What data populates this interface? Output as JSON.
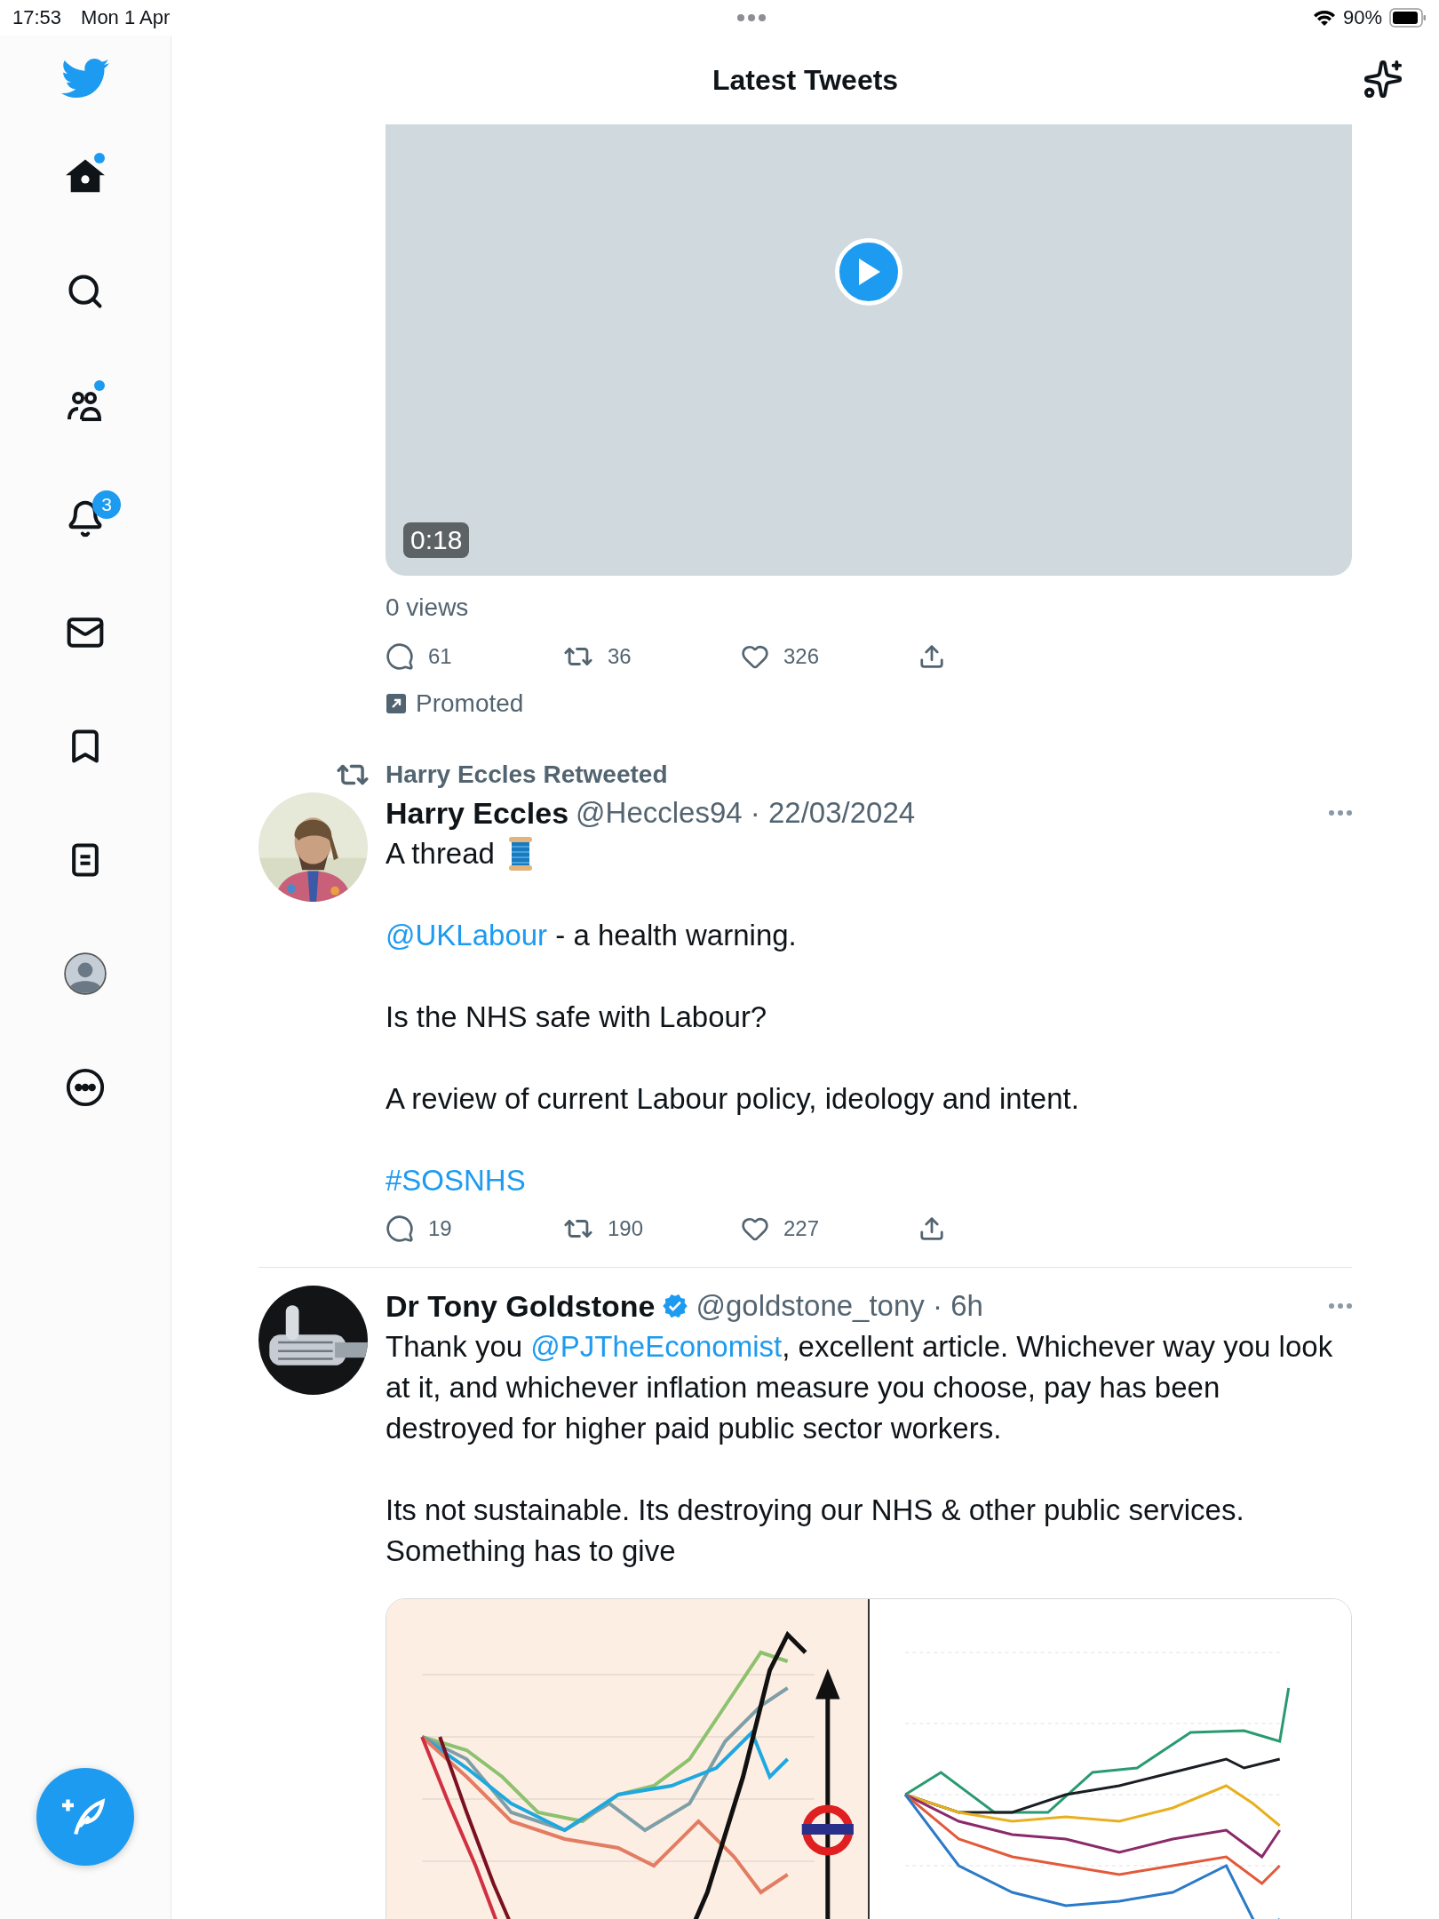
{
  "status_bar": {
    "time": "17:53",
    "date": "Mon 1 Apr",
    "battery": "90%"
  },
  "header": {
    "title": "Latest Tweets"
  },
  "sidebar": {
    "items": [
      {
        "kind": "home",
        "selected": true,
        "unread": true
      },
      {
        "kind": "search",
        "selected": false,
        "unread": false
      },
      {
        "kind": "communities",
        "selected": false,
        "unread": true
      },
      {
        "kind": "notifications",
        "selected": false,
        "unread": false,
        "badge": "3"
      },
      {
        "kind": "messages",
        "selected": false,
        "unread": false
      },
      {
        "kind": "bookmarks",
        "selected": false,
        "unread": false
      },
      {
        "kind": "lists",
        "selected": false,
        "unread": false
      },
      {
        "kind": "profile",
        "selected": false,
        "unread": false
      },
      {
        "kind": "more",
        "selected": false,
        "unread": false
      }
    ]
  },
  "promoted_tweet": {
    "video": {
      "duration": "0:18"
    },
    "views": "0 views",
    "actions": {
      "replies": "61",
      "retweets": "36",
      "likes": "326"
    },
    "label": "Promoted"
  },
  "tweets": [
    {
      "retweeted_by": "Harry Eccles Retweeted",
      "name": "Harry Eccles",
      "byline": "@Heccles94 · 22/03/2024",
      "paragraphs": [
        [
          {
            "text": "A thread"
          }
        ],
        [
          {
            "text": "@UKLabour",
            "link": true
          },
          {
            "text": " - a health warning."
          }
        ],
        [
          {
            "text": "Is the NHS safe with Labour?"
          }
        ],
        [
          {
            "text": "A review of current Labour policy, ideology and intent."
          }
        ],
        [
          {
            "text": "#SOSNHS",
            "link": true
          }
        ]
      ],
      "actions": {
        "replies": "19",
        "retweets": "190",
        "likes": "227"
      }
    },
    {
      "name": "Dr Tony Goldstone",
      "verified": true,
      "byline": "@goldstone_tony · 6h",
      "paragraphs": [
        [
          {
            "text": "Thank you "
          },
          {
            "text": "@PJTheEconomist",
            "link": true
          },
          {
            "text": ", excellent article. Whichever way you look at it, and whichever inflation measure you choose, pay has been destroyed for higher paid public sector workers."
          }
        ],
        [
          {
            "text": "Its not sustainable. Its destroying our NHS & other public services. Something has to give"
          }
        ]
      ],
      "media": [
        {
          "kind": "picture"
        },
        {
          "kind": "picture"
        }
      ]
    }
  ]
}
